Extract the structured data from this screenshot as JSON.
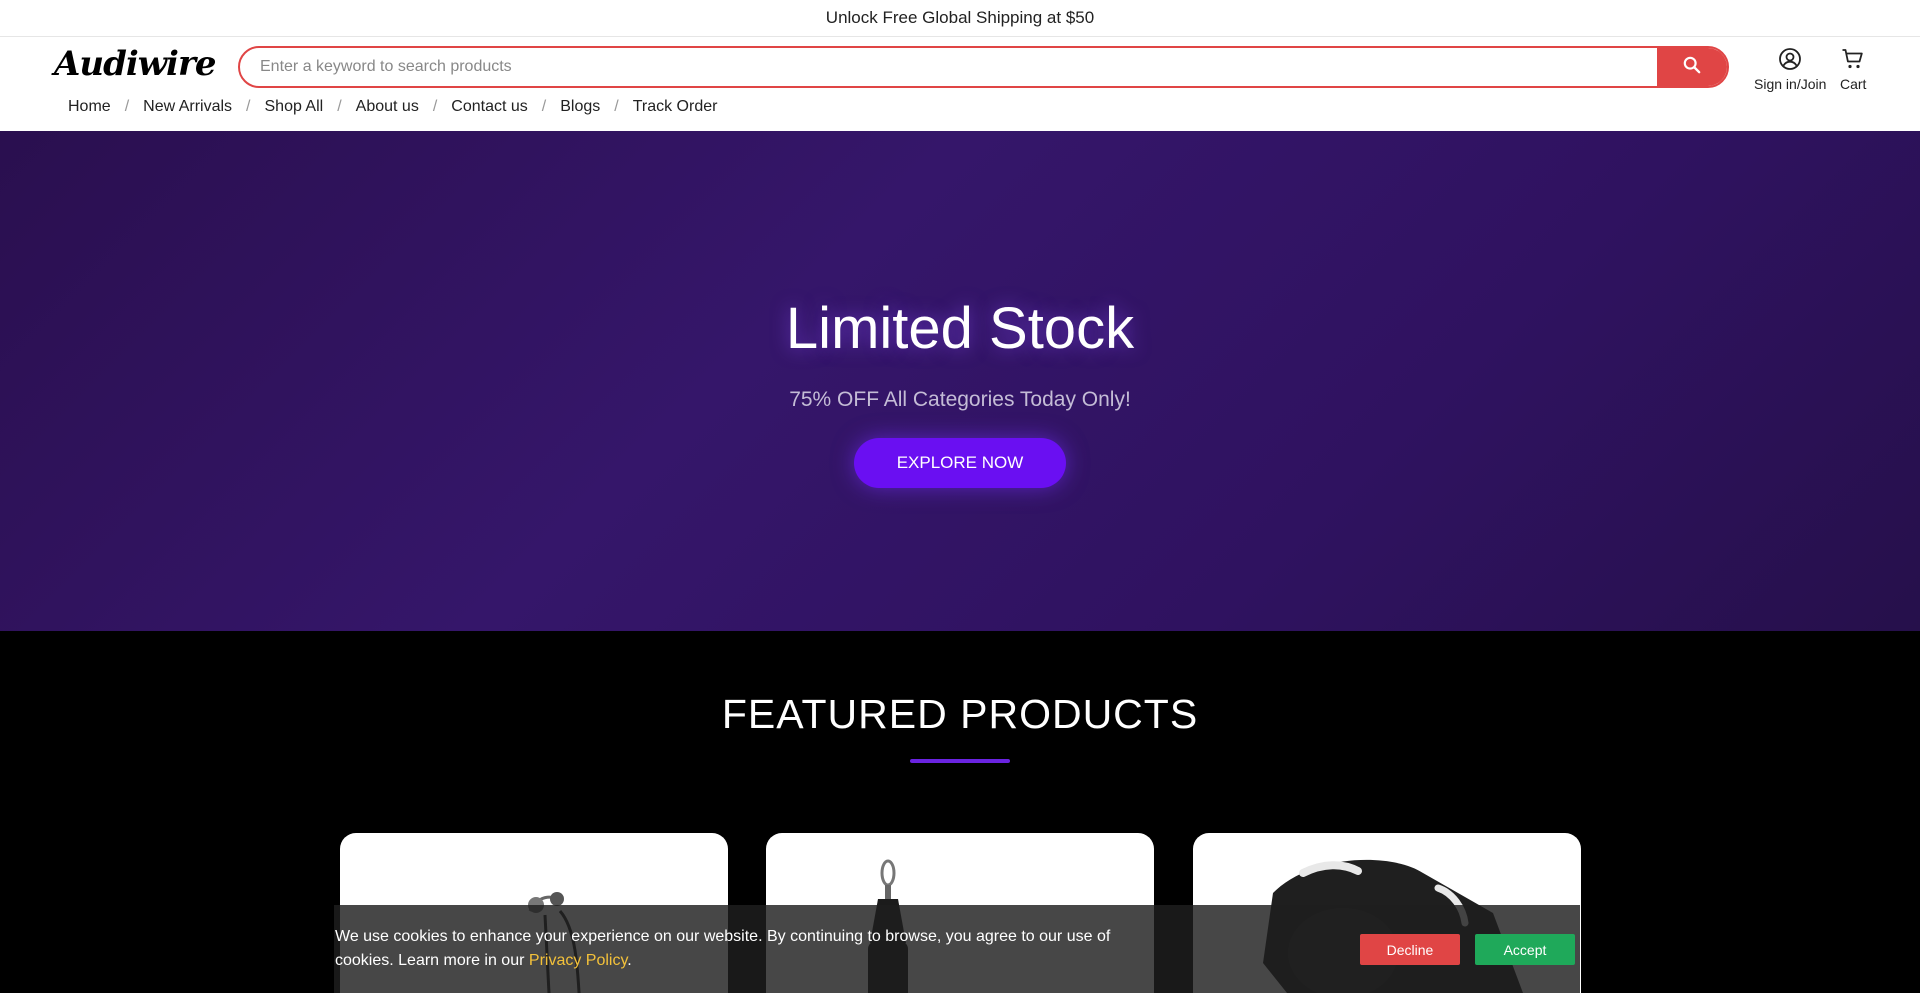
{
  "topbar": {
    "message": "Unlock Free Global Shipping at $50"
  },
  "header": {
    "logo": "Audiwire",
    "search_placeholder": "Enter a keyword to search products",
    "signin_label": "Sign in",
    "join_label": "Join",
    "signin_sep": "/",
    "cart_label": "Cart"
  },
  "nav": {
    "items": [
      "Home",
      "New Arrivals",
      "Shop All",
      "About us",
      "Contact us",
      "Blogs",
      "Track Order"
    ],
    "separator": "/"
  },
  "hero": {
    "title": "Limited Stock",
    "subtitle": "75% OFF All Categories Today Only!",
    "cta": "EXPLORE NOW"
  },
  "featured": {
    "title": "FEATURED PRODUCTS"
  },
  "cookie": {
    "text": "We use cookies to enhance your experience on our website. By continuing to browse, you agree to our use of cookies. Learn more in our",
    "link": "Privacy Policy",
    "period": ".",
    "decline": "Decline",
    "accept": "Accept"
  },
  "colors": {
    "accent_red": "#e04545",
    "hero_purple": "#2f1260",
    "button_purple": "#6a0ff2",
    "accept_green": "#1fa95a",
    "link_yellow": "#f3c13a"
  },
  "icons": {
    "search": "search-icon",
    "account": "user-circle-icon",
    "cart": "cart-icon"
  }
}
